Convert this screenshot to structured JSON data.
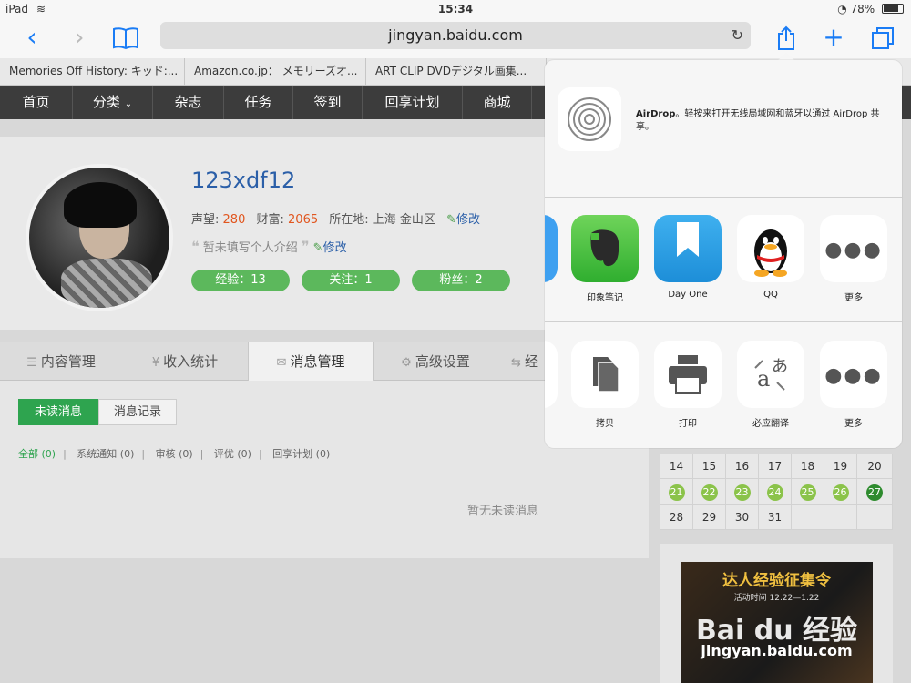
{
  "status": {
    "device": "iPad",
    "time": "15:34",
    "battery": "78%",
    "battery_level": 0.78
  },
  "browser": {
    "url": "jingyan.baidu.com",
    "bookmarks": [
      "Memories Off History: キッド:...",
      "Amazon.co.jp： メモリーズオ...",
      "ART CLIP DVDデジタル画集..."
    ]
  },
  "site_nav": [
    "首页",
    "分类",
    "杂志",
    "任务",
    "签到",
    "回享计划",
    "商城"
  ],
  "profile": {
    "username": "123xdf12",
    "reputation_label": "声望:",
    "reputation": "280",
    "wealth_label": "财富:",
    "wealth": "2065",
    "location_label": "所在地:",
    "location": "上海 金山区",
    "edit": "修改",
    "bio": "暂未填写个人介绍",
    "pills": [
      "经验：13",
      "关注：1",
      "粉丝：2"
    ]
  },
  "tabs": [
    "内容管理",
    "收入统计",
    "消息管理",
    "高级设置",
    "经"
  ],
  "messages": {
    "subtabs": [
      "未读消息",
      "消息记录"
    ],
    "filters": [
      "全部 (0)",
      "系统通知 (0)",
      "审核 (0)",
      "评优 (0)",
      "回享计划 (0)"
    ],
    "empty": "暂无未读消息"
  },
  "calendar": {
    "rows": [
      [
        "14",
        "15",
        "16",
        "17",
        "18",
        "19",
        "20"
      ],
      [
        "21",
        "22",
        "23",
        "24",
        "25",
        "26",
        "27"
      ],
      [
        "28",
        "29",
        "30",
        "31",
        "",
        "",
        ""
      ]
    ]
  },
  "ad": {
    "title": "达人经验征集令",
    "subtitle": "活动时间 12.22—1.22",
    "logo": "Bai du 经验",
    "url": "jingyan.baidu.com"
  },
  "share": {
    "airdrop_title": "AirDrop",
    "airdrop_desc": "。轻按来打开无线局域网和蓝牙以通过 AirDrop 共享。",
    "apps": [
      "印象笔记",
      "Day One",
      "QQ",
      "更多"
    ],
    "actions": [
      "拷贝",
      "打印",
      "必应翻译",
      "更多"
    ]
  }
}
